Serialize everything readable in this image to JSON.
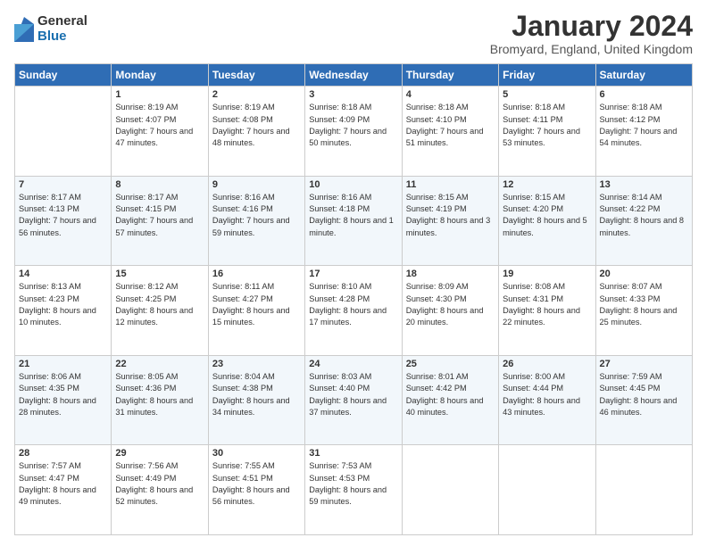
{
  "logo": {
    "general": "General",
    "blue": "Blue"
  },
  "title": "January 2024",
  "location": "Bromyard, England, United Kingdom",
  "days_of_week": [
    "Sunday",
    "Monday",
    "Tuesday",
    "Wednesday",
    "Thursday",
    "Friday",
    "Saturday"
  ],
  "weeks": [
    [
      {
        "day": "",
        "sunrise": "",
        "sunset": "",
        "daylight": ""
      },
      {
        "day": "1",
        "sunrise": "Sunrise: 8:19 AM",
        "sunset": "Sunset: 4:07 PM",
        "daylight": "Daylight: 7 hours and 47 minutes."
      },
      {
        "day": "2",
        "sunrise": "Sunrise: 8:19 AM",
        "sunset": "Sunset: 4:08 PM",
        "daylight": "Daylight: 7 hours and 48 minutes."
      },
      {
        "day": "3",
        "sunrise": "Sunrise: 8:18 AM",
        "sunset": "Sunset: 4:09 PM",
        "daylight": "Daylight: 7 hours and 50 minutes."
      },
      {
        "day": "4",
        "sunrise": "Sunrise: 8:18 AM",
        "sunset": "Sunset: 4:10 PM",
        "daylight": "Daylight: 7 hours and 51 minutes."
      },
      {
        "day": "5",
        "sunrise": "Sunrise: 8:18 AM",
        "sunset": "Sunset: 4:11 PM",
        "daylight": "Daylight: 7 hours and 53 minutes."
      },
      {
        "day": "6",
        "sunrise": "Sunrise: 8:18 AM",
        "sunset": "Sunset: 4:12 PM",
        "daylight": "Daylight: 7 hours and 54 minutes."
      }
    ],
    [
      {
        "day": "7",
        "sunrise": "Sunrise: 8:17 AM",
        "sunset": "Sunset: 4:13 PM",
        "daylight": "Daylight: 7 hours and 56 minutes."
      },
      {
        "day": "8",
        "sunrise": "Sunrise: 8:17 AM",
        "sunset": "Sunset: 4:15 PM",
        "daylight": "Daylight: 7 hours and 57 minutes."
      },
      {
        "day": "9",
        "sunrise": "Sunrise: 8:16 AM",
        "sunset": "Sunset: 4:16 PM",
        "daylight": "Daylight: 7 hours and 59 minutes."
      },
      {
        "day": "10",
        "sunrise": "Sunrise: 8:16 AM",
        "sunset": "Sunset: 4:18 PM",
        "daylight": "Daylight: 8 hours and 1 minute."
      },
      {
        "day": "11",
        "sunrise": "Sunrise: 8:15 AM",
        "sunset": "Sunset: 4:19 PM",
        "daylight": "Daylight: 8 hours and 3 minutes."
      },
      {
        "day": "12",
        "sunrise": "Sunrise: 8:15 AM",
        "sunset": "Sunset: 4:20 PM",
        "daylight": "Daylight: 8 hours and 5 minutes."
      },
      {
        "day": "13",
        "sunrise": "Sunrise: 8:14 AM",
        "sunset": "Sunset: 4:22 PM",
        "daylight": "Daylight: 8 hours and 8 minutes."
      }
    ],
    [
      {
        "day": "14",
        "sunrise": "Sunrise: 8:13 AM",
        "sunset": "Sunset: 4:23 PM",
        "daylight": "Daylight: 8 hours and 10 minutes."
      },
      {
        "day": "15",
        "sunrise": "Sunrise: 8:12 AM",
        "sunset": "Sunset: 4:25 PM",
        "daylight": "Daylight: 8 hours and 12 minutes."
      },
      {
        "day": "16",
        "sunrise": "Sunrise: 8:11 AM",
        "sunset": "Sunset: 4:27 PM",
        "daylight": "Daylight: 8 hours and 15 minutes."
      },
      {
        "day": "17",
        "sunrise": "Sunrise: 8:10 AM",
        "sunset": "Sunset: 4:28 PM",
        "daylight": "Daylight: 8 hours and 17 minutes."
      },
      {
        "day": "18",
        "sunrise": "Sunrise: 8:09 AM",
        "sunset": "Sunset: 4:30 PM",
        "daylight": "Daylight: 8 hours and 20 minutes."
      },
      {
        "day": "19",
        "sunrise": "Sunrise: 8:08 AM",
        "sunset": "Sunset: 4:31 PM",
        "daylight": "Daylight: 8 hours and 22 minutes."
      },
      {
        "day": "20",
        "sunrise": "Sunrise: 8:07 AM",
        "sunset": "Sunset: 4:33 PM",
        "daylight": "Daylight: 8 hours and 25 minutes."
      }
    ],
    [
      {
        "day": "21",
        "sunrise": "Sunrise: 8:06 AM",
        "sunset": "Sunset: 4:35 PM",
        "daylight": "Daylight: 8 hours and 28 minutes."
      },
      {
        "day": "22",
        "sunrise": "Sunrise: 8:05 AM",
        "sunset": "Sunset: 4:36 PM",
        "daylight": "Daylight: 8 hours and 31 minutes."
      },
      {
        "day": "23",
        "sunrise": "Sunrise: 8:04 AM",
        "sunset": "Sunset: 4:38 PM",
        "daylight": "Daylight: 8 hours and 34 minutes."
      },
      {
        "day": "24",
        "sunrise": "Sunrise: 8:03 AM",
        "sunset": "Sunset: 4:40 PM",
        "daylight": "Daylight: 8 hours and 37 minutes."
      },
      {
        "day": "25",
        "sunrise": "Sunrise: 8:01 AM",
        "sunset": "Sunset: 4:42 PM",
        "daylight": "Daylight: 8 hours and 40 minutes."
      },
      {
        "day": "26",
        "sunrise": "Sunrise: 8:00 AM",
        "sunset": "Sunset: 4:44 PM",
        "daylight": "Daylight: 8 hours and 43 minutes."
      },
      {
        "day": "27",
        "sunrise": "Sunrise: 7:59 AM",
        "sunset": "Sunset: 4:45 PM",
        "daylight": "Daylight: 8 hours and 46 minutes."
      }
    ],
    [
      {
        "day": "28",
        "sunrise": "Sunrise: 7:57 AM",
        "sunset": "Sunset: 4:47 PM",
        "daylight": "Daylight: 8 hours and 49 minutes."
      },
      {
        "day": "29",
        "sunrise": "Sunrise: 7:56 AM",
        "sunset": "Sunset: 4:49 PM",
        "daylight": "Daylight: 8 hours and 52 minutes."
      },
      {
        "day": "30",
        "sunrise": "Sunrise: 7:55 AM",
        "sunset": "Sunset: 4:51 PM",
        "daylight": "Daylight: 8 hours and 56 minutes."
      },
      {
        "day": "31",
        "sunrise": "Sunrise: 7:53 AM",
        "sunset": "Sunset: 4:53 PM",
        "daylight": "Daylight: 8 hours and 59 minutes."
      },
      {
        "day": "",
        "sunrise": "",
        "sunset": "",
        "daylight": ""
      },
      {
        "day": "",
        "sunrise": "",
        "sunset": "",
        "daylight": ""
      },
      {
        "day": "",
        "sunrise": "",
        "sunset": "",
        "daylight": ""
      }
    ]
  ]
}
